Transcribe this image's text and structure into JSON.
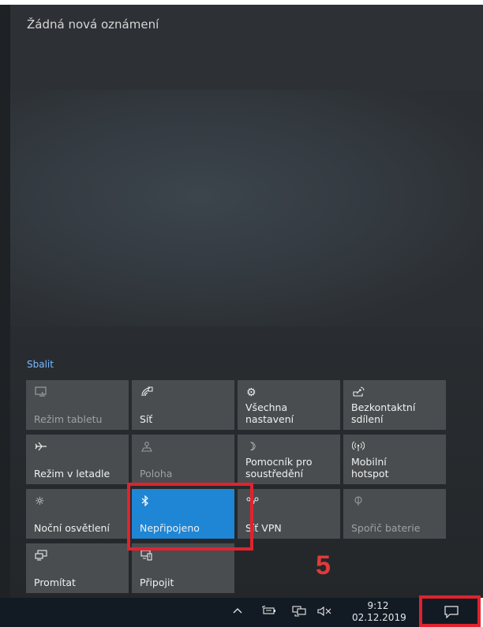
{
  "action_center": {
    "no_notifications": "Žádná nová oznámení",
    "collapse_label": "Sbalit",
    "tiles": [
      {
        "label": "Režim tabletu",
        "icon": "tablet-mode-icon",
        "disabled": true,
        "active": false
      },
      {
        "label": "Síť",
        "icon": "network-icon",
        "disabled": false,
        "active": false
      },
      {
        "label": "Všechna\nnastavení",
        "icon": "gear-icon",
        "disabled": false,
        "active": false
      },
      {
        "label": "Bezkontaktní\nsdílení",
        "icon": "nearby-share-icon",
        "disabled": false,
        "active": false
      },
      {
        "label": "Režim v letadle",
        "icon": "airplane-icon",
        "disabled": false,
        "active": false
      },
      {
        "label": "Poloha",
        "icon": "location-icon",
        "disabled": true,
        "active": false
      },
      {
        "label": "Pomocník pro\nsoustředění",
        "icon": "moon-icon",
        "disabled": false,
        "active": false
      },
      {
        "label": "Mobilní\nhotspot",
        "icon": "hotspot-icon",
        "disabled": false,
        "active": false
      },
      {
        "label": "Noční osvětlení",
        "icon": "brightness-icon",
        "disabled": false,
        "active": false
      },
      {
        "label": "Nepřipojeno",
        "icon": "bluetooth-icon",
        "disabled": false,
        "active": true
      },
      {
        "label": "Síť VPN",
        "icon": "vpn-icon",
        "disabled": false,
        "active": false
      },
      {
        "label": "Spořič baterie",
        "icon": "battery-saver-icon",
        "disabled": true,
        "active": false
      },
      {
        "label": "Promítat",
        "icon": "project-icon",
        "disabled": false,
        "active": false
      },
      {
        "label": "Připojit",
        "icon": "connect-icon",
        "disabled": false,
        "active": false
      }
    ]
  },
  "annotation": {
    "step": "5",
    "color": "#e0232e"
  },
  "taskbar": {
    "time": "9:12",
    "date": "02.12.2019",
    "icons": [
      "chevron-up-icon",
      "battery-icon",
      "network-wired-icon",
      "speaker-muted-icon",
      "action-center-icon"
    ]
  }
}
